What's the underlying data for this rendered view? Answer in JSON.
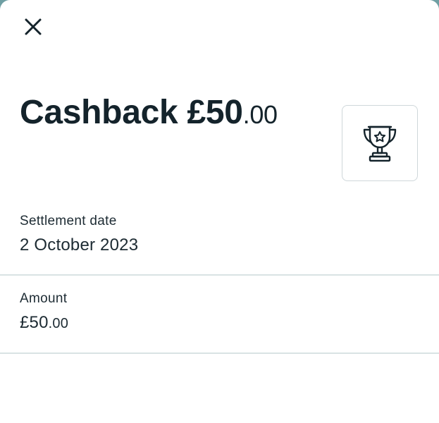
{
  "header": {
    "close_icon": "close-icon",
    "close_label": "Close"
  },
  "cashback": {
    "title_prefix": "Cashback",
    "amount_whole": "£50",
    "amount_decimal": ".00",
    "badge_icon": "trophy-star-icon"
  },
  "details": [
    {
      "label": "Settlement date",
      "value": "2 October 2023"
    },
    {
      "label": "Amount",
      "value_whole": "£50",
      "value_decimal": ".00"
    }
  ],
  "colors": {
    "text": "#14232b",
    "divider": "#d9e3e4",
    "tile_border": "#cfd7da",
    "backdrop": "#6f9fa3"
  }
}
